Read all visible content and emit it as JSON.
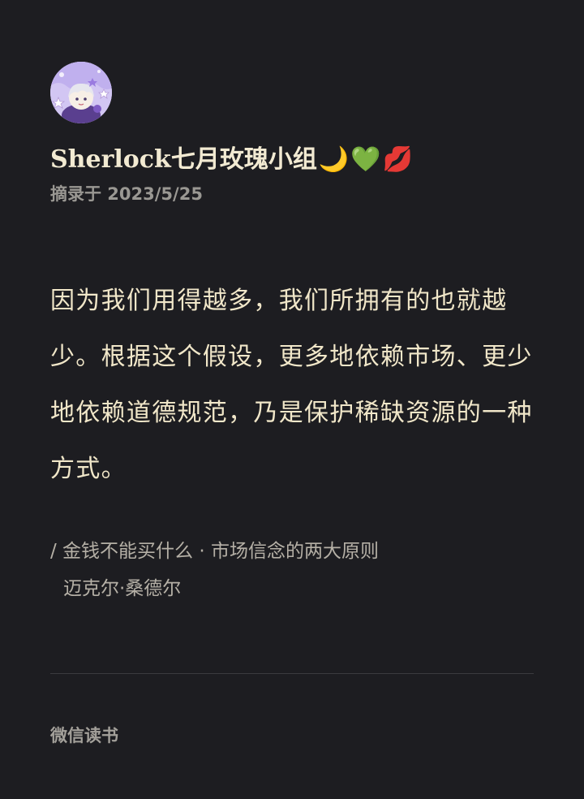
{
  "header": {
    "user_name": "Sherlock七月玫瑰小组",
    "emojis": [
      "🌙",
      "💚",
      "💋"
    ],
    "excerpt_date": "摘录于 2023/5/25"
  },
  "quote": {
    "text": "因为我们用得越多，我们所拥有的也就越少。根据这个假设，更多地依赖市场、更少地依赖道德规范，乃是保护稀缺资源的一种方式。"
  },
  "source": {
    "book": "/ 金钱不能买什么 · 市场信念的两大原则",
    "author": "迈克尔·桑德尔"
  },
  "footer": {
    "app_name": "微信读书"
  }
}
